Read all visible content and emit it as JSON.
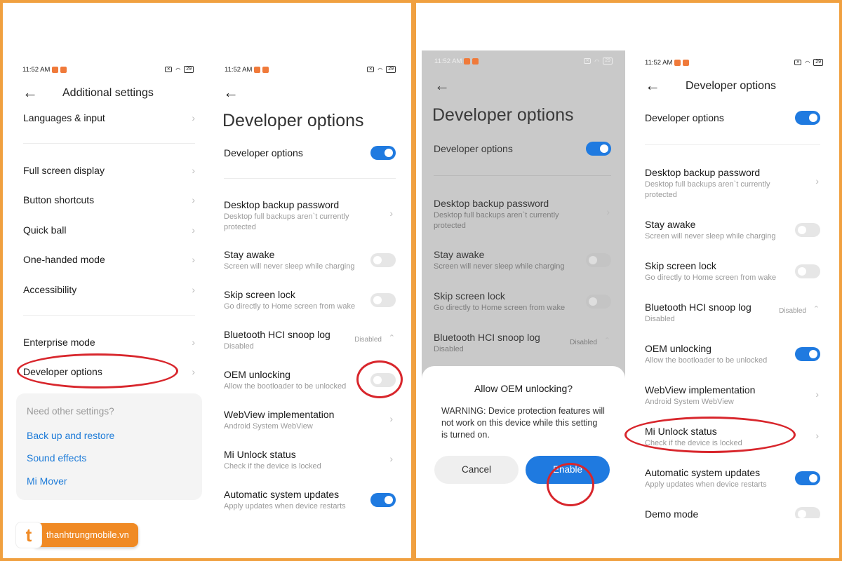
{
  "status": {
    "time": "11:52 AM",
    "battery": "29"
  },
  "s1": {
    "title": "Additional settings",
    "items": [
      "Languages & input",
      "Full screen display",
      "Button shortcuts",
      "Quick ball",
      "One-handed mode",
      "Accessibility",
      "Enterprise mode",
      "Developer options"
    ],
    "card": {
      "heading": "Need other settings?",
      "links": [
        "Back up and restore",
        "Sound effects",
        "Mi Mover"
      ]
    }
  },
  "dev": {
    "title": "Developer options",
    "master": "Developer options",
    "backup_t": "Desktop backup password",
    "backup_s1": "Desktop full backups aren`t currently",
    "backup_s2": "protected",
    "stay_t": "Stay awake",
    "stay_s": "Screen will never sleep while charging",
    "skip_t": "Skip screen lock",
    "skip_s": "Go directly to Home screen from wake",
    "bt_t": "Bluetooth HCI snoop log",
    "bt_s": "Disabled",
    "bt_v": "Disabled",
    "oem_t": "OEM unlocking",
    "oem_s": "Allow the bootloader to be unlocked",
    "web_t": "WebView implementation",
    "web_s": "Android System WebView",
    "mi_t": "Mi Unlock status",
    "mi_s": "Check if the device is locked",
    "auto_t": "Automatic system updates",
    "auto_s": "Apply updates when device restarts",
    "demo_t": "Demo mode"
  },
  "dialog": {
    "title": "Allow OEM unlocking?",
    "message": "WARNING: Device protection features will not work on this device while this setting is turned on.",
    "cancel": "Cancel",
    "enable": "Enable"
  },
  "logo": {
    "text": "thanhtrungmobile.vn",
    "glyph": "t"
  },
  "colors": {
    "accent": "#1f7ae0",
    "frame": "#f0a040",
    "highlight": "#d8262c",
    "brand": "#f08a24"
  }
}
